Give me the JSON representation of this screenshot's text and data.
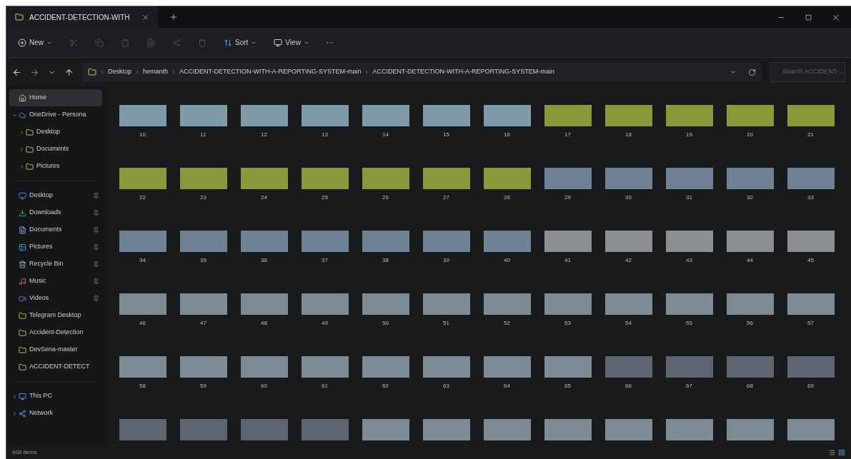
{
  "tab": {
    "title": "ACCIDENT-DETECTION-WITH"
  },
  "toolbar": {
    "new": "New",
    "sort": "Sort",
    "view": "View",
    "more": "···"
  },
  "address": {
    "crumbs": [
      "Desktop",
      "hemanth",
      "ACCIDENT-DETECTION-WITH-A-REPORTING-SYSTEM-main",
      "ACCIDENT-DETECTION-WITH-A-REPORTING-SYSTEM-main"
    ],
    "search_placeholder": "Search ACCIDENT-..."
  },
  "sidebar": [
    [
      {
        "label": "Home",
        "kind": "home",
        "selected": true
      },
      {
        "label": "OneDrive - Persona",
        "kind": "cloud",
        "selected": false,
        "expanded": true,
        "children": [
          {
            "label": "Desktop",
            "kind": "folder",
            "selected": false,
            "expanded": false
          },
          {
            "label": "Documents",
            "kind": "folder",
            "selected": false,
            "expanded": false
          },
          {
            "label": "Pictures",
            "kind": "folder",
            "selected": false,
            "expanded": false
          }
        ]
      }
    ],
    [
      {
        "label": "Desktop",
        "kind": "desktop",
        "selected": false,
        "pinned": true
      },
      {
        "label": "Downloads",
        "kind": "download",
        "selected": false,
        "pinned": true
      },
      {
        "label": "Documents",
        "kind": "document",
        "selected": false,
        "pinned": true
      },
      {
        "label": "Pictures",
        "kind": "picture",
        "selected": false,
        "pinned": true
      },
      {
        "label": "Recycle Bin",
        "kind": "bin",
        "selected": false,
        "pinned": true
      },
      {
        "label": "Music",
        "kind": "music",
        "selected": false,
        "pinned": true
      },
      {
        "label": "Videos",
        "kind": "video",
        "selected": false,
        "pinned": true
      },
      {
        "label": "Telegram Desktop",
        "kind": "folder",
        "selected": false,
        "pinned": false
      },
      {
        "label": "Accident-Detection",
        "kind": "folder",
        "selected": false,
        "pinned": false
      },
      {
        "label": "DevSena-master",
        "kind": "folder",
        "selected": false,
        "pinned": false
      },
      {
        "label": "ACCIDENT-DETECT",
        "kind": "folder",
        "selected": false,
        "pinned": false
      }
    ],
    [
      {
        "label": "This PC",
        "kind": "pc",
        "selected": false,
        "expanded": false
      },
      {
        "label": "Network",
        "kind": "network",
        "selected": false,
        "expanded": false
      }
    ]
  ],
  "files": [
    {
      "name": "10",
      "kind": "street"
    },
    {
      "name": "11",
      "kind": "street"
    },
    {
      "name": "12",
      "kind": "street"
    },
    {
      "name": "13",
      "kind": "street"
    },
    {
      "name": "14",
      "kind": "street"
    },
    {
      "name": "15",
      "kind": "street"
    },
    {
      "name": "16",
      "kind": "street"
    },
    {
      "name": "17",
      "kind": "highway"
    },
    {
      "name": "18",
      "kind": "highway"
    },
    {
      "name": "19",
      "kind": "highway"
    },
    {
      "name": "20",
      "kind": "highway"
    },
    {
      "name": "21",
      "kind": "highway"
    },
    {
      "name": "22",
      "kind": "highway"
    },
    {
      "name": "23",
      "kind": "highway"
    },
    {
      "name": "24",
      "kind": "highway"
    },
    {
      "name": "25",
      "kind": "highway"
    },
    {
      "name": "26",
      "kind": "highway"
    },
    {
      "name": "27",
      "kind": "highway"
    },
    {
      "name": "28",
      "kind": "highway"
    },
    {
      "name": "29",
      "kind": "plaza"
    },
    {
      "name": "30",
      "kind": "plaza"
    },
    {
      "name": "31",
      "kind": "plaza"
    },
    {
      "name": "32",
      "kind": "plaza"
    },
    {
      "name": "33",
      "kind": "plaza"
    },
    {
      "name": "34",
      "kind": "plaza"
    },
    {
      "name": "35",
      "kind": "plaza"
    },
    {
      "name": "36",
      "kind": "plaza"
    },
    {
      "name": "37",
      "kind": "plaza"
    },
    {
      "name": "38",
      "kind": "plaza"
    },
    {
      "name": "39",
      "kind": "plaza"
    },
    {
      "name": "40",
      "kind": "plaza"
    },
    {
      "name": "41",
      "kind": "wreck"
    },
    {
      "name": "42",
      "kind": "wreck"
    },
    {
      "name": "43",
      "kind": "wreck"
    },
    {
      "name": "44",
      "kind": "wreck"
    },
    {
      "name": "45",
      "kind": "wreck"
    },
    {
      "name": "46",
      "kind": "road"
    },
    {
      "name": "47",
      "kind": "road"
    },
    {
      "name": "48",
      "kind": "road"
    },
    {
      "name": "49",
      "kind": "road"
    },
    {
      "name": "50",
      "kind": "road"
    },
    {
      "name": "51",
      "kind": "road"
    },
    {
      "name": "52",
      "kind": "road"
    },
    {
      "name": "53",
      "kind": "road"
    },
    {
      "name": "54",
      "kind": "road"
    },
    {
      "name": "55",
      "kind": "road"
    },
    {
      "name": "56",
      "kind": "road"
    },
    {
      "name": "57",
      "kind": "road"
    },
    {
      "name": "58",
      "kind": "road"
    },
    {
      "name": "59",
      "kind": "road"
    },
    {
      "name": "60",
      "kind": "road"
    },
    {
      "name": "61",
      "kind": "road"
    },
    {
      "name": "62",
      "kind": "road"
    },
    {
      "name": "63",
      "kind": "road"
    },
    {
      "name": "64",
      "kind": "road"
    },
    {
      "name": "65",
      "kind": "road"
    },
    {
      "name": "66",
      "kind": "overpass"
    },
    {
      "name": "67",
      "kind": "overpass"
    },
    {
      "name": "68",
      "kind": "overpass"
    },
    {
      "name": "69",
      "kind": "overpass"
    },
    {
      "kind": "overpass"
    },
    {
      "kind": "overpass"
    },
    {
      "kind": "overpass"
    },
    {
      "kind": "overpass"
    },
    {
      "kind": "road"
    },
    {
      "kind": "road"
    },
    {
      "kind": "road"
    },
    {
      "kind": "road"
    },
    {
      "kind": "road"
    },
    {
      "kind": "road"
    },
    {
      "kind": "road"
    },
    {
      "kind": "road"
    }
  ],
  "status_bar": {
    "count": "608 items"
  }
}
